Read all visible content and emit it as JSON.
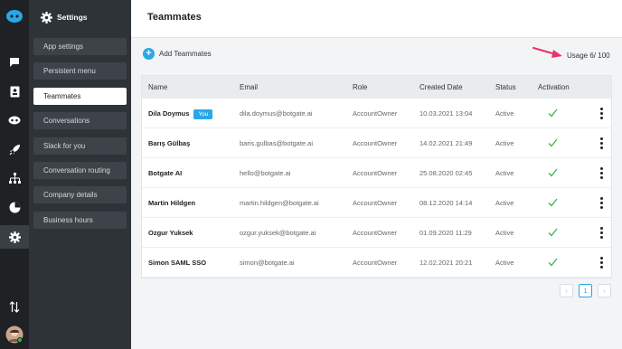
{
  "rail": {
    "icons": [
      "logo-icon",
      "chat-icon",
      "contacts-icon",
      "bot-icon",
      "rocket-icon",
      "flow-icon",
      "analytics-icon",
      "settings-icon",
      "sort-icon",
      "avatar"
    ]
  },
  "settings_panel": {
    "title": "Settings",
    "items": [
      {
        "label": "App settings"
      },
      {
        "label": "Persistent menu"
      },
      {
        "label": "Teammates"
      },
      {
        "label": "Conversations"
      },
      {
        "label": "Slack for you"
      },
      {
        "label": "Conversation routing"
      },
      {
        "label": "Company details"
      },
      {
        "label": "Business hours"
      }
    ]
  },
  "main": {
    "title": "Teammates",
    "add_label": "Add Teammates",
    "usage_label": "Usage 6/ 100"
  },
  "table": {
    "columns": [
      "Name",
      "Email",
      "Role",
      "Created Date",
      "Status",
      "Activation"
    ],
    "you_badge": "You",
    "rows": [
      {
        "name": "Dila Doymus",
        "email": "dila.doymus@botgate.ai",
        "role": "AccountOwner",
        "created": "10.03.2021 13:04",
        "status": "Active"
      },
      {
        "name": "Barış Gülbaş",
        "email": "baris.gulbas@botgate.ai",
        "role": "AccountOwner",
        "created": "14.02.2021 21:49",
        "status": "Active"
      },
      {
        "name": "Botgate AI",
        "email": "hello@botgate.ai",
        "role": "AccountOwner",
        "created": "25.08.2020 02:45",
        "status": "Active"
      },
      {
        "name": "Martin Hildgen",
        "email": "martin.hildgen@botgate.ai",
        "role": "AccountOwner",
        "created": "08.12.2020 14:14",
        "status": "Active"
      },
      {
        "name": "Ozgur Yuksek",
        "email": "ozgur.yuksek@botgate.ai",
        "role": "AccountOwner",
        "created": "01.09.2020 11:29",
        "status": "Active"
      },
      {
        "name": "Simon SAML SSO",
        "email": "simon@botgate.ai",
        "role": "AccountOwner",
        "created": "12.02.2021 20:21",
        "status": "Active"
      }
    ]
  },
  "pagination": {
    "prev": "‹",
    "current": "1",
    "next": "›"
  },
  "colors": {
    "accent": "#2aa7e6",
    "check": "#3bb54a",
    "arrow": "#e8336a",
    "rail": "#1f2225",
    "panel": "#2e3338"
  }
}
